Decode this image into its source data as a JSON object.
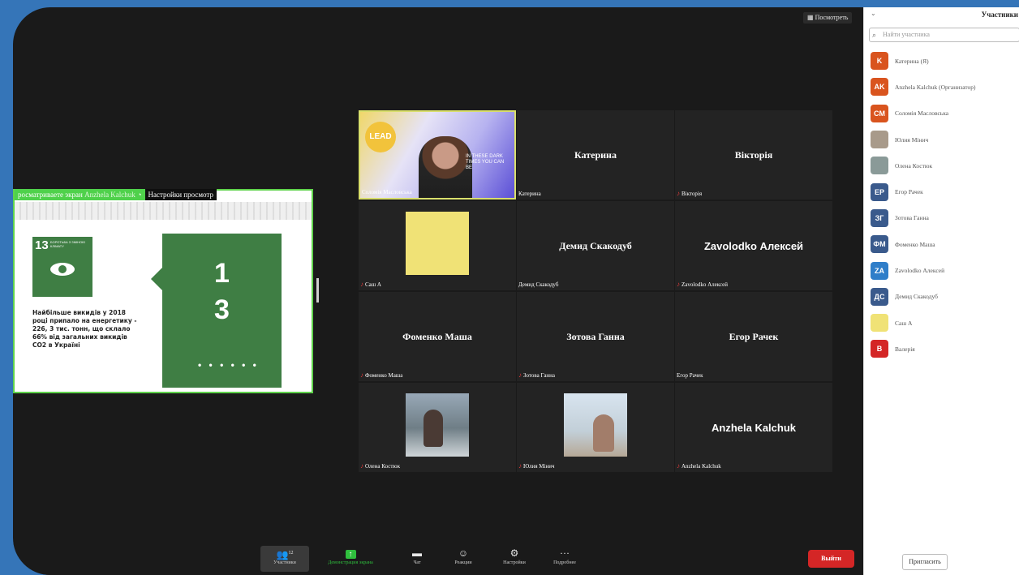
{
  "toolbar_top": {
    "view_label": "Посмотреть"
  },
  "share": {
    "viewing_prefix": "росматриваете экран",
    "presenter": "Anzhela Kalchuk",
    "settings_label": "Настройки просмотр",
    "slide": {
      "sdg_number": "13",
      "sdg_title": "БОРОТЬБА З ЗМІНОЮ КЛІМАТУ",
      "text": "Найбільше викидів у 2018 році припало на енергетику - 226, 3 тис. тонн, що склало 66% від загальних викидів CO2 в Україні",
      "big_digit_1": "1",
      "big_digit_2": "3",
      "dots": "• • • • • •"
    }
  },
  "tiles": [
    {
      "label": "Соломія Масловська",
      "center": "",
      "muted": false,
      "kind": "video"
    },
    {
      "label": "Катерина",
      "center": "Катерина",
      "muted": false
    },
    {
      "label": "Вікторія",
      "center": "Вікторія",
      "muted": true
    },
    {
      "label": "Саш А",
      "center": "",
      "muted": true,
      "kind": "yellow"
    },
    {
      "label": "Демид Скакодуб",
      "center": "Демид Скакодуб",
      "muted": false
    },
    {
      "label": "Zavolodko Алексей",
      "center": "Zavolodko Алексей",
      "muted": true
    },
    {
      "label": "Фоменко Маша",
      "center": "Фоменко Маша",
      "muted": true
    },
    {
      "label": "Зотова Ганна",
      "center": "Зотова Ганна",
      "muted": true
    },
    {
      "label": "Егор Рачек",
      "center": "Егор Рачек",
      "muted": false
    },
    {
      "label": "Олена Костюк",
      "center": "",
      "muted": true,
      "kind": "photo1"
    },
    {
      "label": "Юлия Мінич",
      "center": "",
      "muted": true,
      "kind": "photo2"
    },
    {
      "label": "Anzhela Kalchuk",
      "center": "Anzhela Kalchuk",
      "muted": true
    }
  ],
  "video_text": {
    "lead": "LEAD",
    "quote": "IN THESE DARK TIMES YOU CAN BE"
  },
  "bottom_bar": {
    "participants_label": "Участники",
    "participants_count": "12",
    "share_label": "Демонстрация экрана",
    "chat_label": "Чат",
    "reactions_label": "Реакции",
    "settings_label": "Настройки",
    "more_label": "Подробнее",
    "leave_label": "Выйти"
  },
  "panel": {
    "title": "Участники",
    "search_placeholder": "Найти участника",
    "participants": [
      {
        "initials": "K",
        "name": "Катерина (Я)",
        "color": "#d9541e"
      },
      {
        "initials": "AK",
        "name": "Anzhela Kalchuk (Организатор)",
        "color": "#d9541e"
      },
      {
        "initials": "CM",
        "name": "Соломія Масловська",
        "color": "#d9541e"
      },
      {
        "initials": "",
        "name": "Юлия Мінич",
        "color": "#a89a8a"
      },
      {
        "initials": "",
        "name": "Олена Костюк",
        "color": "#8a9a98"
      },
      {
        "initials": "ЕР",
        "name": "Егор Рачек",
        "color": "#3a5a8c"
      },
      {
        "initials": "ЗГ",
        "name": "Зотова Ганна",
        "color": "#3a5a8c"
      },
      {
        "initials": "ФМ",
        "name": "Фоменко Маша",
        "color": "#3a5a8c"
      },
      {
        "initials": "ZA",
        "name": "Zavolodko Алексей",
        "color": "#2f7ec9"
      },
      {
        "initials": "ДС",
        "name": "Демид Скакодуб",
        "color": "#3a5a8c"
      },
      {
        "initials": "",
        "name": "Саш А",
        "color": "#f0e276"
      },
      {
        "initials": "В",
        "name": "Валерія",
        "color": "#d42626"
      }
    ],
    "invite_label": "Пригласить"
  }
}
